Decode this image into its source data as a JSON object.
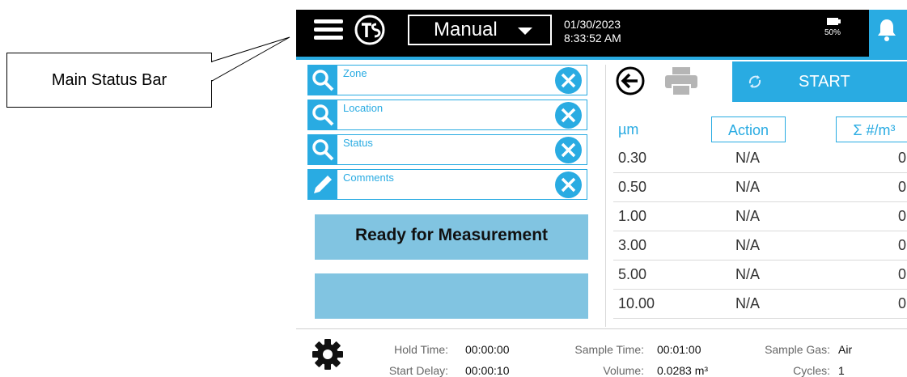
{
  "annotation": {
    "label": "Main Status Bar"
  },
  "status_bar": {
    "mode": "Manual",
    "date": "01/30/2023",
    "time": "8:33:52 AM",
    "battery": "50%",
    "menu_icon": "hamburger-menu-icon",
    "logo_icon": "tsi-logo-icon",
    "bell_icon": "bell-icon"
  },
  "filters": [
    {
      "label": "Zone",
      "icon": "search-icon"
    },
    {
      "label": "Location",
      "icon": "search-icon"
    },
    {
      "label": "Status",
      "icon": "search-icon"
    },
    {
      "label": "Comments",
      "icon": "pencil-icon"
    }
  ],
  "status_message": "Ready for Measurement",
  "toolbar": {
    "start_label": "START",
    "back_icon": "back-arrow-icon",
    "print_icon": "printer-icon",
    "refresh_icon": "refresh-icon"
  },
  "table": {
    "headers": [
      "µm",
      "Action",
      "Σ #/m³"
    ],
    "rows": [
      {
        "size": "0.30",
        "action": "N/A",
        "count": "0"
      },
      {
        "size": "0.50",
        "action": "N/A",
        "count": "0"
      },
      {
        "size": "1.00",
        "action": "N/A",
        "count": "0"
      },
      {
        "size": "3.00",
        "action": "N/A",
        "count": "0"
      },
      {
        "size": "5.00",
        "action": "N/A",
        "count": "0"
      },
      {
        "size": "10.00",
        "action": "N/A",
        "count": "0"
      }
    ]
  },
  "footer": {
    "hold_time_label": "Hold Time:",
    "hold_time": "00:00:00",
    "start_delay_label": "Start Delay:",
    "start_delay": "00:00:10",
    "sample_time_label": "Sample Time:",
    "sample_time": "00:01:00",
    "volume_label": "Volume:",
    "volume": "0.0283 m³",
    "sample_gas_label": "Sample Gas:",
    "sample_gas": "Air",
    "cycles_label": "Cycles:",
    "cycles": "1",
    "settings_icon": "gear-icon"
  },
  "colors": {
    "accent": "#29abe2",
    "status_box": "#81c4e1",
    "bar": "#000000"
  }
}
